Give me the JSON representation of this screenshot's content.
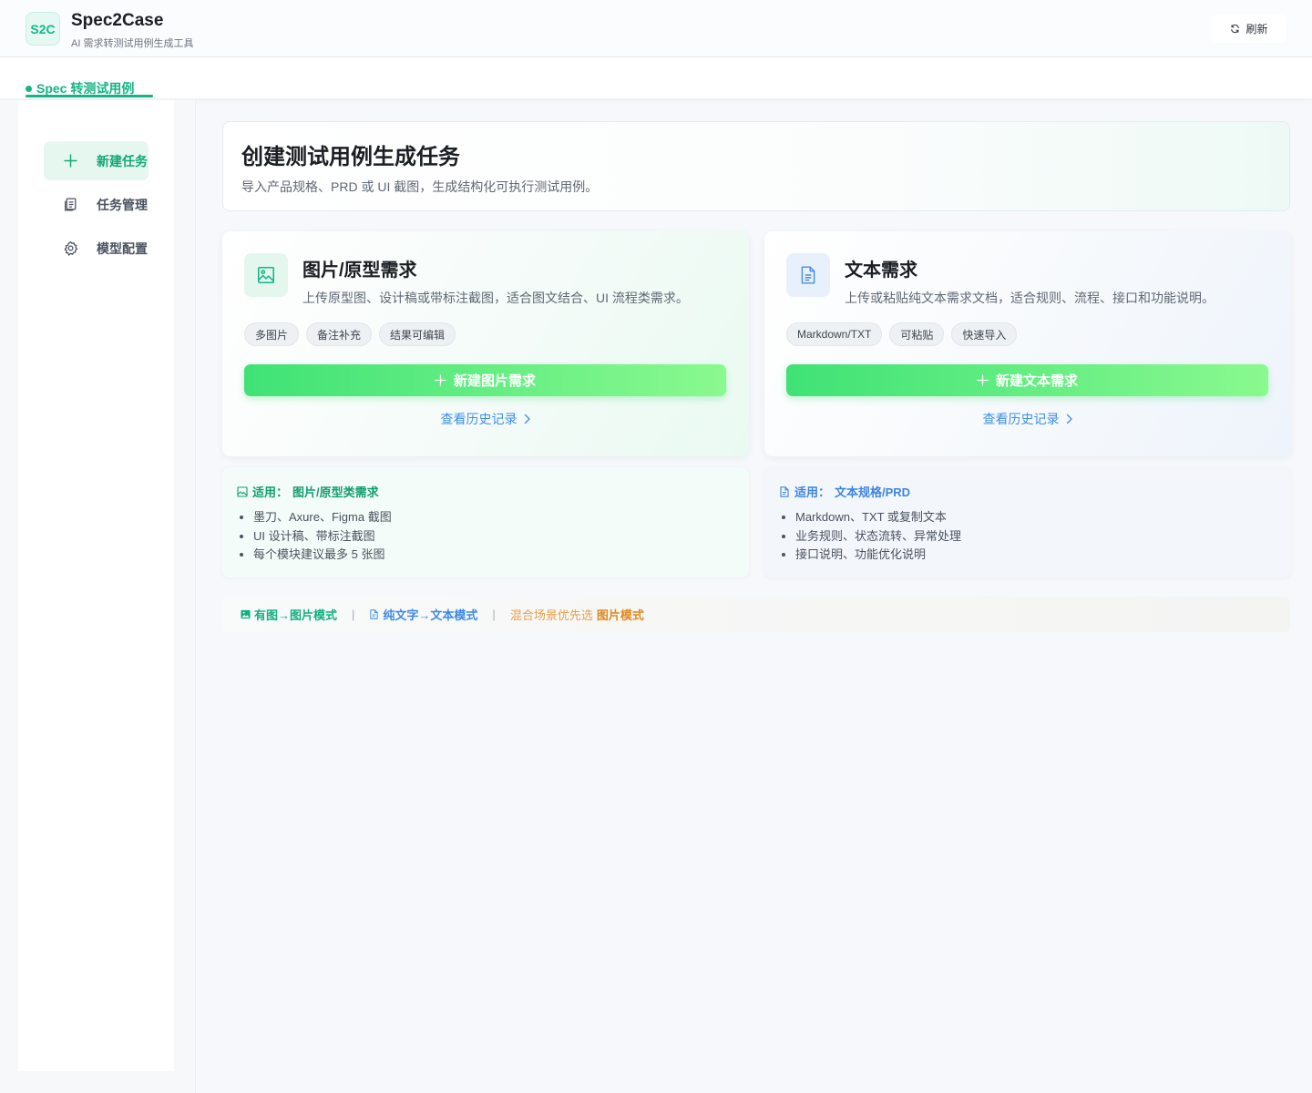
{
  "header": {
    "logo": "S2C",
    "title": "Spec2Case",
    "subtitle": "AI 需求转测试用例生成工具",
    "refresh_label": "刷新"
  },
  "tabs": [
    {
      "label": "Spec 转测试用例",
      "active": true
    }
  ],
  "sidebar": {
    "items": [
      {
        "label": "新建任务",
        "icon": "plus-icon",
        "active": true
      },
      {
        "label": "任务管理",
        "icon": "document-stack-icon",
        "active": false
      },
      {
        "label": "模型配置",
        "icon": "gear-icon",
        "active": false
      }
    ]
  },
  "intro": {
    "title": "创建测试用例生成任务",
    "description": "导入产品规格、PRD 或 UI 截图，生成结构化可执行测试用例。"
  },
  "modes": {
    "image": {
      "icon": "image-icon",
      "title": "图片/原型需求",
      "description": "上传原型图、设计稿或带标注截图，适合图文结合、UI 流程类需求。",
      "tags": [
        "多图片",
        "备注补充",
        "结果可编辑"
      ],
      "create_label": "新建图片需求",
      "history_label": "查看历史记录"
    },
    "text": {
      "icon": "file-text-icon",
      "title": "文本需求",
      "description": "上传或粘贴纯文本需求文档，适合规则、流程、接口和功能说明。",
      "tags": [
        "Markdown/TXT",
        "可粘贴",
        "快速导入"
      ],
      "create_label": "新建文本需求",
      "history_label": "查看历史记录"
    }
  },
  "info": {
    "image": {
      "prefix": "适用：",
      "title": "图片/原型类需求",
      "items": [
        "墨刀、Axure、Figma 截图",
        "UI 设计稿、带标注截图",
        "每个模块建议最多 5 张图"
      ]
    },
    "text": {
      "prefix": "适用：",
      "title": "文本规格/PRD",
      "items": [
        "Markdown、TXT 或复制文本",
        "业务规则、状态流转、异常处理",
        "接口说明、功能优化说明"
      ]
    }
  },
  "hints": {
    "image_hint": "有图→图片模式",
    "text_hint": "纯文字→文本模式",
    "mixed_prefix": "混合场景优先选",
    "mixed_emphasis": "图片模式",
    "separator": "|"
  },
  "colors": {
    "brand_green": "#16b483",
    "accent_blue": "#3f8eea",
    "accent_orange": "#e08a22"
  }
}
